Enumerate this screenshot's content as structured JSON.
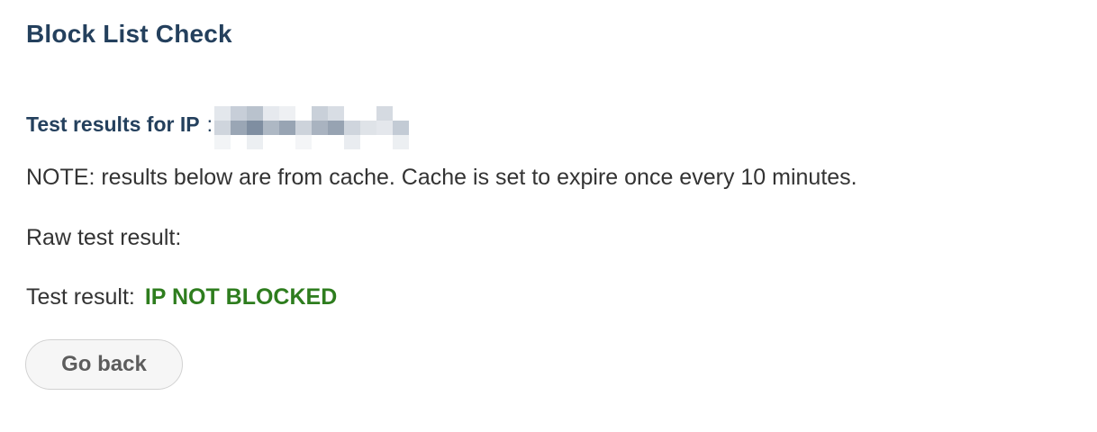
{
  "page": {
    "title": "Block List Check"
  },
  "results": {
    "heading": "Test results for IP",
    "separator": ":"
  },
  "note": "NOTE: results below are from cache. Cache is set to expire once every 10 minutes.",
  "raw_result": {
    "label": "Raw test result:"
  },
  "test_result": {
    "label": "Test result:",
    "value": "IP NOT BLOCKED",
    "value_color": "#2e7d1e"
  },
  "actions": {
    "go_back_label": "Go back"
  }
}
